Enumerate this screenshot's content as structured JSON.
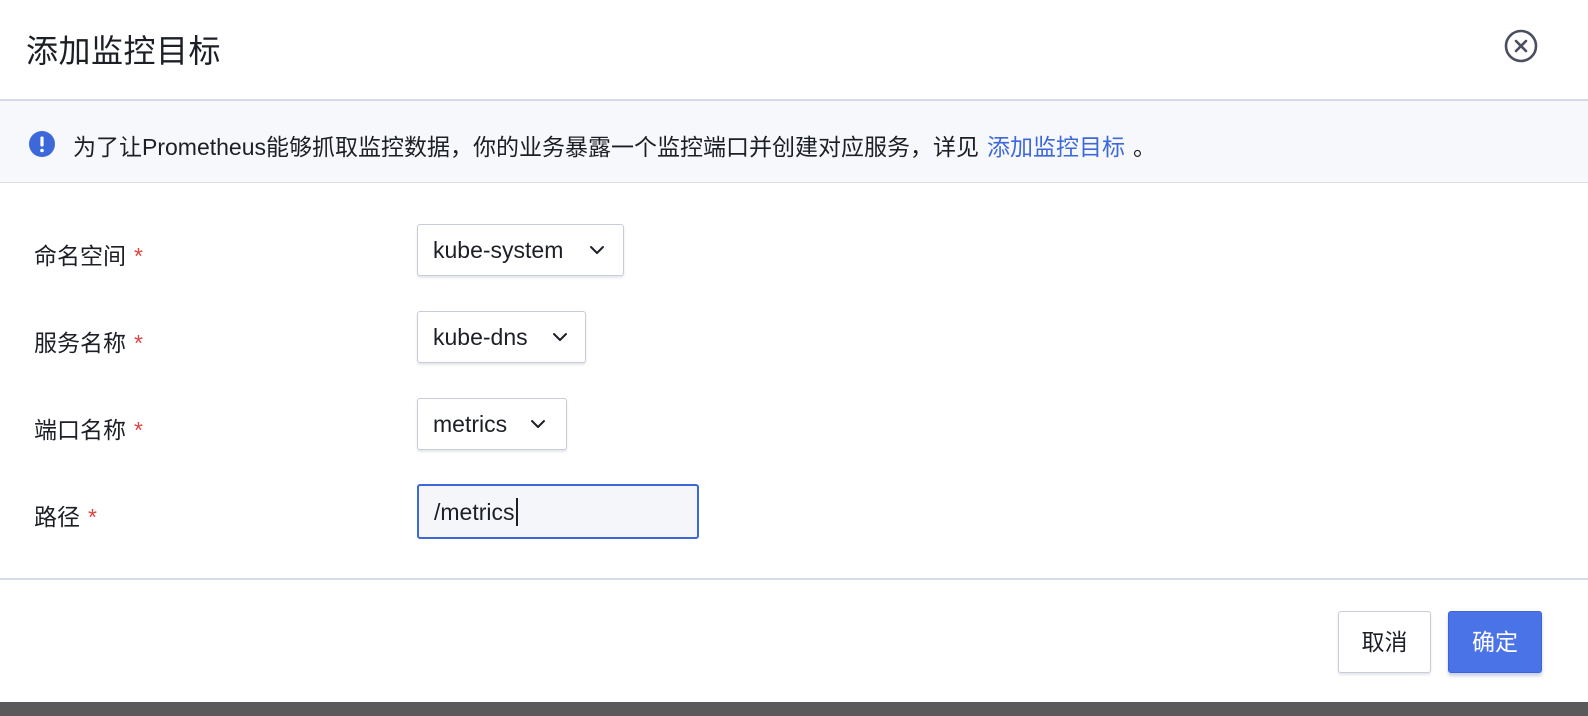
{
  "dialog": {
    "title": "添加监控目标",
    "close_icon": "close-circle-icon"
  },
  "notice": {
    "icon": "info-circle-icon",
    "icon_color": "#3d68d9",
    "text": "为了让Prometheus能够抓取监控数据，你的业务暴露一个监控端口并创建对应服务，详见",
    "link_label": "添加监控目标",
    "suffix": "。"
  },
  "form": {
    "required_mark": "*",
    "namespace": {
      "label": "命名空间",
      "value": "kube-system"
    },
    "service": {
      "label": "服务名称",
      "value": "kube-dns"
    },
    "port": {
      "label": "端口名称",
      "value": "metrics"
    },
    "path": {
      "label": "路径",
      "value": "/metrics"
    }
  },
  "footer": {
    "cancel_label": "取消",
    "ok_label": "确定"
  },
  "colors": {
    "primary": "#4a73e8",
    "link": "#3d68d9",
    "required": "#e0443f"
  }
}
